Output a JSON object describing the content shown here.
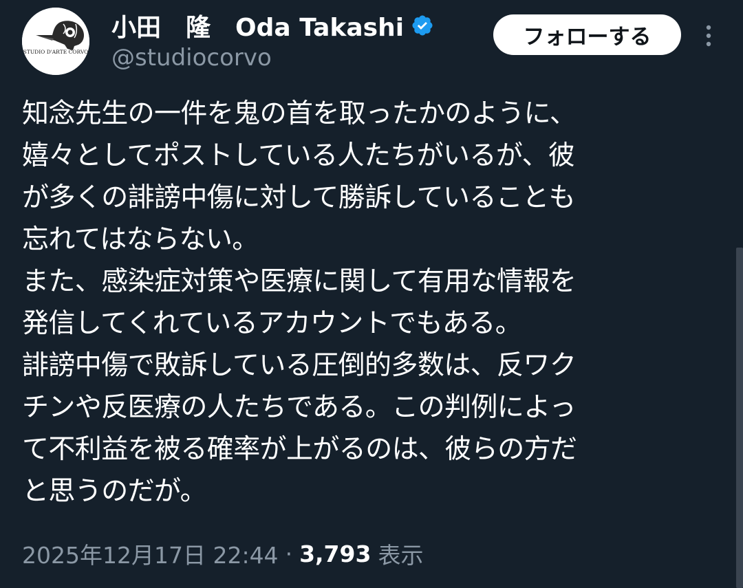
{
  "author": {
    "display_name": "小田　隆　Oda Takashi",
    "handle": "@studiocorvo",
    "avatar_text": "STUDIO D'ARTE CORVO",
    "verified": true,
    "verified_color": "#1d9bf0"
  },
  "actions": {
    "follow_label": "フォローする",
    "more_icon": "more-vertical-icon"
  },
  "post": {
    "lines": [
      "知念先生の一件を鬼の首を取ったかのように、",
      "嬉々としてポストしている人たちがいるが、彼",
      "が多くの誹謗中傷に対して勝訴していることも",
      "忘れてはならない。",
      "また、感染症対策や医療に関して有用な情報を",
      "発信してくれているアカウントでもある。",
      "誹謗中傷で敗訴している圧倒的多数は、反ワク",
      "チンや反医療の人たちである。この判例によっ",
      "て不利益を被る確率が上がるのは、彼らの方だ",
      "と思うのだが。"
    ]
  },
  "meta": {
    "timestamp": "2025年12月17日 22:44",
    "separator": "·",
    "views_count": "3,793",
    "views_label": "表示"
  },
  "colors": {
    "background": "#15202b",
    "text": "#ffffff",
    "secondary_text": "#8b98a5",
    "follow_bg": "#ffffff",
    "follow_text": "#0f1419"
  }
}
